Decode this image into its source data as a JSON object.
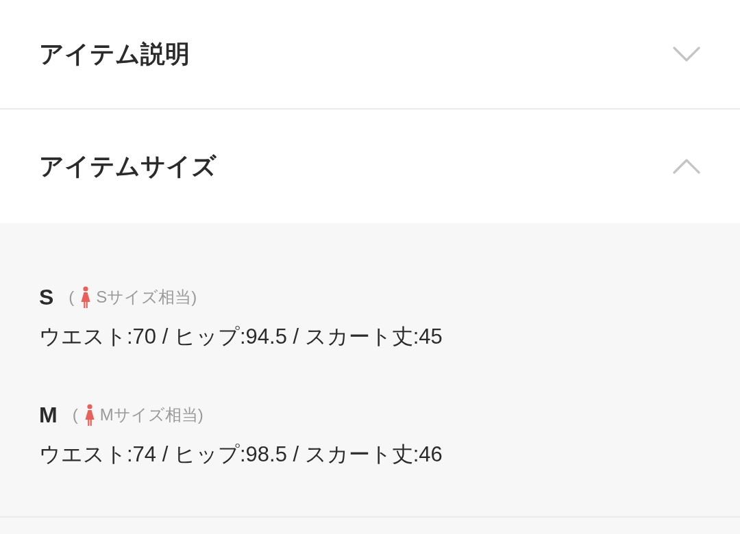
{
  "sections": [
    {
      "title": "アイテム説明",
      "expanded": false
    },
    {
      "title": "アイテムサイズ",
      "expanded": true,
      "sizes": [
        {
          "size": "S",
          "open_paren": "(",
          "equivalent": "Sサイズ相当)",
          "measurements": "ウエスト:70 / ヒップ:94.5 / スカート丈:45"
        },
        {
          "size": "M",
          "open_paren": "(",
          "equivalent": "Mサイズ相当)",
          "measurements": "ウエスト:74 / ヒップ:98.5 / スカート丈:46"
        }
      ]
    }
  ]
}
